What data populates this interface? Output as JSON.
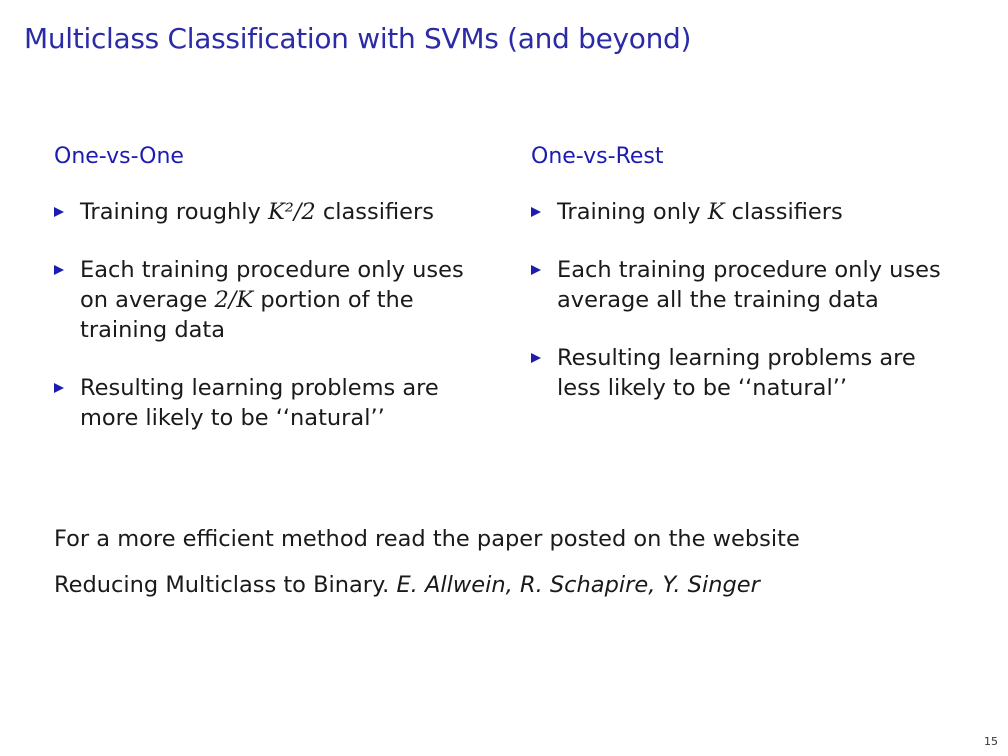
{
  "slide": {
    "title": "Multiclass Classification with SVMs (and beyond)",
    "page_number": "15"
  },
  "left_column": {
    "heading": "One-vs-One",
    "items": [
      {
        "pre": "Training roughly ",
        "math": "K²/2",
        "post": " classifiers"
      },
      {
        "pre": "Each training procedure only uses on average ",
        "math": "2/K",
        "post": " portion of the training data"
      },
      {
        "pre": "Resulting learning problems are more likely to be ‘‘natural’’",
        "math": "",
        "post": ""
      }
    ]
  },
  "right_column": {
    "heading": "One-vs-Rest",
    "items": [
      {
        "pre": "Training only ",
        "math": "K",
        "post": " classifiers"
      },
      {
        "pre": "Each training procedure only uses average all the training data",
        "math": "",
        "post": ""
      },
      {
        "pre": "Resulting learning problems are less likely to be ‘‘natural’’",
        "math": "",
        "post": ""
      }
    ]
  },
  "footer": {
    "line1": "For a more efficient method read the paper posted on the website",
    "paper_title": "Reducing Multiclass to Binary. ",
    "authors": "E. Allwein, R. Schapire, Y. Singer"
  },
  "colors": {
    "title": "#2b2ba8",
    "accent": "#1c1cb0",
    "text": "#1a1a1a"
  }
}
